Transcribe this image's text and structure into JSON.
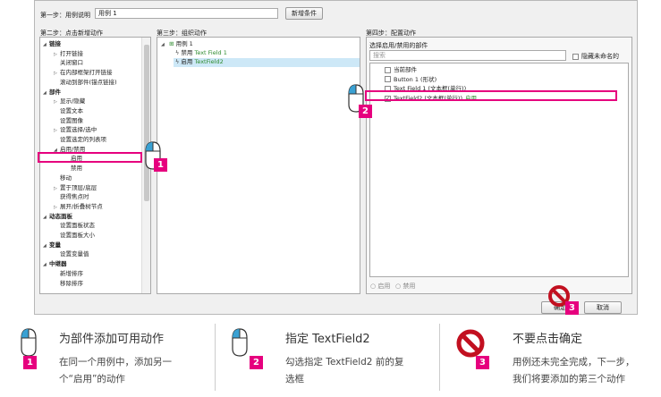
{
  "step1": {
    "label": "第一步：用例说明",
    "value": "用例 1",
    "button": "新增条件"
  },
  "step2": {
    "label": "第二步：点击新增动作",
    "tree": [
      {
        "t": "链接",
        "lvl": 0,
        "bold": true,
        "exp": "down"
      },
      {
        "t": "打开链接",
        "lvl": 1,
        "exp": "right"
      },
      {
        "t": "关闭窗口",
        "lvl": 1
      },
      {
        "t": "在内部框架打开链接",
        "lvl": 1,
        "exp": "right"
      },
      {
        "t": "滚动到部件(锚点链接)",
        "lvl": 1
      },
      {
        "t": "部件",
        "lvl": 0,
        "bold": true,
        "exp": "down"
      },
      {
        "t": "显示/隐藏",
        "lvl": 1,
        "exp": "right"
      },
      {
        "t": "设置文本",
        "lvl": 1
      },
      {
        "t": "设置图像",
        "lvl": 1
      },
      {
        "t": "设置选择/选中",
        "lvl": 1,
        "exp": "right"
      },
      {
        "t": "设置选定的列表项",
        "lvl": 1
      },
      {
        "t": "启用/禁用",
        "lvl": 1,
        "exp": "down"
      },
      {
        "t": "启用",
        "lvl": 2
      },
      {
        "t": "禁用",
        "lvl": 2
      },
      {
        "t": "移动",
        "lvl": 1
      },
      {
        "t": "置于顶层/底层",
        "lvl": 1,
        "exp": "right"
      },
      {
        "t": "获得焦点时",
        "lvl": 1
      },
      {
        "t": "展开/折叠树节点",
        "lvl": 1,
        "exp": "right"
      },
      {
        "t": "动态面板",
        "lvl": 0,
        "bold": true,
        "exp": "down"
      },
      {
        "t": "设置面板状态",
        "lvl": 1
      },
      {
        "t": "设置面板大小",
        "lvl": 1
      },
      {
        "t": "变量",
        "lvl": 0,
        "bold": true,
        "exp": "down"
      },
      {
        "t": "设置变量值",
        "lvl": 1
      },
      {
        "t": "中继器",
        "lvl": 0,
        "bold": true,
        "exp": "down"
      },
      {
        "t": "新增排序",
        "lvl": 1
      },
      {
        "t": "移除排序",
        "lvl": 1
      }
    ]
  },
  "step3": {
    "label": "第三步：组织动作",
    "case_label": "用例 1",
    "actions": [
      {
        "verb": "禁用",
        "target": "Text Field 1"
      },
      {
        "verb": "启用",
        "target": "TextField2"
      }
    ]
  },
  "step4": {
    "label": "第四步：配置动作",
    "sub_label": "选择启用/禁用的部件",
    "search_placeholder": "搜索",
    "hide_unnamed": "隐藏未命名的",
    "widgets": [
      {
        "name": "当前部件",
        "checked": false,
        "suffix": ""
      },
      {
        "name": "Button 1 (形状)",
        "checked": false,
        "suffix": ""
      },
      {
        "name": "Text Field 1 (文本框(单行))",
        "checked": false,
        "suffix": ""
      },
      {
        "name": "TextField2 (文本框(单行))",
        "checked": true,
        "suffix": "启用"
      }
    ],
    "radio_enable": "启用",
    "radio_disable": "禁用"
  },
  "buttons": {
    "ok": "确定",
    "cancel": "取消"
  },
  "badges": {
    "b1": "1",
    "b2": "2",
    "b3": "3"
  },
  "instructions": [
    {
      "num": "1",
      "title": "为部件添加可用动作",
      "line1": "在同一个用例中，添加另一",
      "line2": "个“启用”的动作"
    },
    {
      "num": "2",
      "title": "指定 TextField2",
      "line1": "勾选指定 TextField2 前的复",
      "line2": "选框"
    },
    {
      "num": "3",
      "title": "不要点击确定",
      "line1": "用例还未完全完成，下一步，",
      "line2": "我们将要添加的第三个动作"
    }
  ],
  "colors": {
    "accent": "#e6007e",
    "green": "#2e8b2e",
    "selected_row": "#cde8f7"
  }
}
